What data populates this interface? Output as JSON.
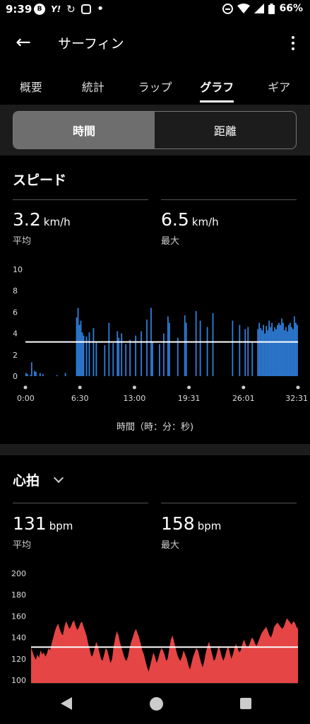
{
  "status_bar": {
    "time": "9:39",
    "icons": [
      "b-icon",
      "yahoo-icon",
      "sync-icon",
      "instagram-icon",
      "dot-icon"
    ],
    "battery": "66%"
  },
  "app_bar": {
    "title": "サーフィン"
  },
  "tabs": [
    {
      "label": "概要",
      "active": false
    },
    {
      "label": "統計",
      "active": false
    },
    {
      "label": "ラップ",
      "active": false
    },
    {
      "label": "グラフ",
      "active": true
    },
    {
      "label": "ギア",
      "active": false
    }
  ],
  "segmented": {
    "options": [
      "時間",
      "距離"
    ],
    "selected": "時間"
  },
  "speed": {
    "title": "スピード",
    "avg_value": "3.2",
    "avg_unit": "km/h",
    "avg_label": "平均",
    "max_value": "6.5",
    "max_unit": "km/h",
    "max_label": "最大",
    "x_title": "時間（時：分：秒)"
  },
  "heart_rate": {
    "title": "心拍",
    "avg_value": "131",
    "avg_unit": "bpm",
    "avg_label": "平均",
    "max_value": "158",
    "max_unit": "bpm",
    "max_label": "最大"
  },
  "chart_data": [
    {
      "type": "bar",
      "color": "#2f7fdc",
      "avg_line": 3.2,
      "ylim": [
        0,
        10
      ],
      "y_ticks": [
        0,
        2,
        4,
        6,
        8,
        10
      ],
      "x_ticks": [
        "0:00",
        "6:30",
        "13:00",
        "19:31",
        "26:01",
        "32:31"
      ],
      "xlabel": "時間（時：分：秒)",
      "ylabel": "",
      "series": [
        {
          "values": [
            0.3,
            0.2,
            0,
            0.1,
            1.3,
            0,
            0.5,
            0.4,
            0,
            0,
            0.3,
            0,
            0.2,
            0,
            0,
            0,
            0,
            0,
            0,
            0,
            0,
            0,
            0.1,
            0,
            0,
            0,
            0,
            0,
            0.3,
            0,
            0,
            0,
            0,
            0,
            0,
            0,
            5.5,
            6.4,
            4.8,
            5.2,
            4.1,
            3.8,
            0,
            3.7,
            0,
            4.1,
            0,
            0,
            4.5,
            0,
            3.2,
            0,
            0,
            0,
            0,
            0,
            2.9,
            0,
            0,
            5.0,
            0,
            0,
            3.1,
            0,
            0,
            4.2,
            3.6,
            0,
            4.0,
            0,
            0,
            3.0,
            0,
            0,
            3.4,
            0,
            0,
            0,
            3.8,
            0,
            0,
            0,
            4.2,
            0,
            0,
            0,
            5.3,
            0,
            0,
            6.4,
            3.2,
            0,
            0,
            0,
            0,
            3.0,
            0,
            0,
            4.0,
            0,
            0,
            5.6,
            5.0,
            0,
            0,
            0,
            0,
            0,
            3.6,
            0,
            0,
            0,
            0,
            5.7,
            5.0,
            0,
            0,
            0,
            0,
            0,
            0,
            6.1,
            0,
            0,
            5.2,
            0,
            0,
            0,
            0,
            4.6,
            0,
            0,
            0,
            5.9,
            0,
            0,
            0,
            0,
            0,
            0,
            0,
            0,
            0,
            0,
            0,
            0,
            0,
            5.2,
            0,
            0,
            0,
            0,
            4.8,
            0,
            0,
            0,
            4.4,
            0,
            4.6,
            0,
            0,
            3.2,
            0,
            0,
            0,
            4.4,
            5.0,
            4.5,
            4.3,
            4.8,
            4.0,
            4.7,
            4.3,
            5.2,
            4.6,
            5.0,
            4.2,
            4.6,
            4.4,
            4.8,
            5.0,
            4.8,
            5.4,
            5.0,
            4.3,
            4.6,
            4.2,
            4.8,
            5.0,
            4.6,
            4.4,
            5.6,
            5.0,
            4.8
          ]
        }
      ]
    },
    {
      "type": "area",
      "color": "#e54545",
      "avg_line": 131,
      "ylim": [
        100,
        200
      ],
      "y_ticks": [
        100,
        120,
        140,
        160,
        180,
        200
      ],
      "series": [
        {
          "values": [
            131,
            126,
            122,
            119,
            124,
            121,
            128,
            124,
            126,
            122,
            125,
            130,
            128,
            135,
            140,
            146,
            150,
            153,
            148,
            144,
            142,
            150,
            155,
            152,
            148,
            150,
            154,
            156,
            151,
            147,
            149,
            153,
            155,
            150,
            146,
            141,
            134,
            128,
            122,
            124,
            130,
            136,
            132,
            126,
            120,
            118,
            124,
            130,
            128,
            122,
            116,
            120,
            132,
            140,
            146,
            142,
            135,
            130,
            125,
            120,
            118,
            122,
            130,
            136,
            140,
            145,
            148,
            144,
            140,
            134,
            128,
            124,
            118,
            112,
            108,
            114,
            120,
            126,
            122,
            116,
            120,
            126,
            130,
            128,
            124,
            118,
            120,
            130,
            138,
            142,
            136,
            130,
            124,
            120,
            118,
            122,
            128,
            124,
            120,
            114,
            110,
            116,
            122,
            126,
            130,
            128,
            122,
            116,
            112,
            118,
            126,
            132,
            136,
            130,
            124,
            118,
            120,
            126,
            132,
            128,
            122,
            118,
            122,
            128,
            132,
            126,
            120,
            124,
            130,
            134,
            130,
            126,
            128,
            134,
            138,
            134,
            130,
            132,
            136,
            140,
            138,
            134,
            132,
            136,
            140,
            144,
            146,
            148,
            150,
            146,
            142,
            140,
            144,
            150,
            152,
            154,
            152,
            150,
            148,
            150,
            154,
            158,
            156,
            154,
            152,
            155,
            154,
            150,
            148
          ]
        }
      ]
    }
  ]
}
